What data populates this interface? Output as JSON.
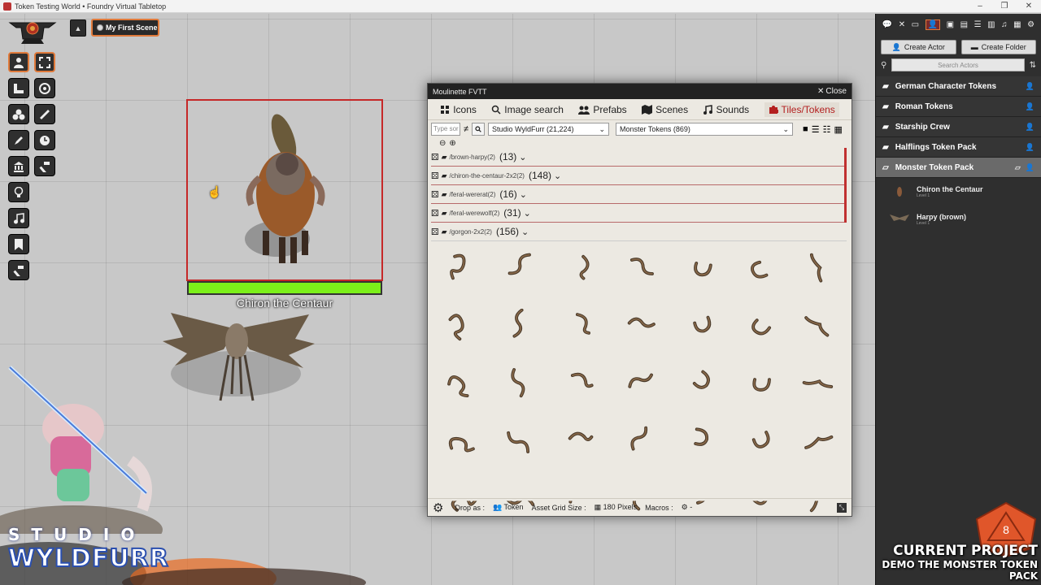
{
  "window": {
    "title": "Token Testing World • Foundry Virtual Tabletop",
    "minimize": "–",
    "maximize": "❐",
    "close": "✕"
  },
  "scene_nav": {
    "toggle": "▲",
    "scene_name": "My First Scene"
  },
  "token": {
    "name": "Chiron the Centaur",
    "hp_fraction": 1.0
  },
  "colors": {
    "accent": "#e07a3b",
    "selection": "#c62828",
    "hp": "#7cf01a",
    "active_tab": "#b42020"
  },
  "controls": [
    "token-icon",
    "fullscreen-icon",
    "ruler-icon",
    "target-icon",
    "tiles-icon",
    "measure-icon",
    "pencil-icon",
    "clock-icon",
    "bank-icon",
    "hammer-icon",
    "lightbulb-icon",
    "music-icon",
    "bookmark-icon",
    "hammer-icon"
  ],
  "moulinette": {
    "title": "Moulinette FVTT",
    "close_label": "Close",
    "tabs": [
      {
        "label": "Icons",
        "icon": "shield-icon"
      },
      {
        "label": "Image search",
        "icon": "search-icon"
      },
      {
        "label": "Prefabs",
        "icon": "users-icon"
      },
      {
        "label": "Scenes",
        "icon": "map-icon"
      },
      {
        "label": "Sounds",
        "icon": "music-icon"
      },
      {
        "label": "Tiles/Tokens",
        "icon": "puzzle-icon"
      }
    ],
    "filter": {
      "search_placeholder": "Type sor",
      "neq": "≠",
      "creator": "Studio WyldFurr (21,224)",
      "pack": "Monster Tokens (869)"
    },
    "folders": [
      {
        "path": "/brown-harpy(2)",
        "count": "(13)"
      },
      {
        "path": "/chiron-the-centaur-2x2(2)",
        "count": "(148)"
      },
      {
        "path": "/feral-wererat(2)",
        "count": "(16)"
      },
      {
        "path": "/feral-werewolf(2)",
        "count": "(31)"
      },
      {
        "path": "/gorgon-2x2(2)",
        "count": "(156)"
      }
    ],
    "footer": {
      "drop_as_label": "Drop as :",
      "drop_as_value": "Token",
      "grid_label": "Asset Grid Size :",
      "grid_value": "180 Pixels",
      "macros_label": "Macros :",
      "macros_value": "-"
    }
  },
  "sidebar": {
    "tabs": [
      "chat-icon",
      "combat-icon",
      "scenes-icon",
      "actors-icon",
      "items-icon",
      "journal-icon",
      "tables-icon",
      "cards-icon",
      "playlists-icon",
      "compendium-icon",
      "settings-icon"
    ],
    "create_actor": "Create Actor",
    "create_folder": "Create Folder",
    "search_placeholder": "Search Actors",
    "folders": [
      {
        "name": "German Character Tokens"
      },
      {
        "name": "Roman Tokens"
      },
      {
        "name": "Starship Crew"
      },
      {
        "name": "Halflings Token Pack"
      },
      {
        "name": "Monster Token Pack"
      }
    ],
    "actors": [
      {
        "name": "Chiron the Centaur",
        "level": "Level 1"
      },
      {
        "name": "Harpy (brown)",
        "level": "Level 1"
      }
    ],
    "overlay": {
      "line1": "CURRENT PROJECT",
      "line2": "DEMO THE MONSTER TOKEN PACK"
    }
  },
  "studio": {
    "line1": "STUDIO",
    "line2": "WYLDFURR"
  }
}
